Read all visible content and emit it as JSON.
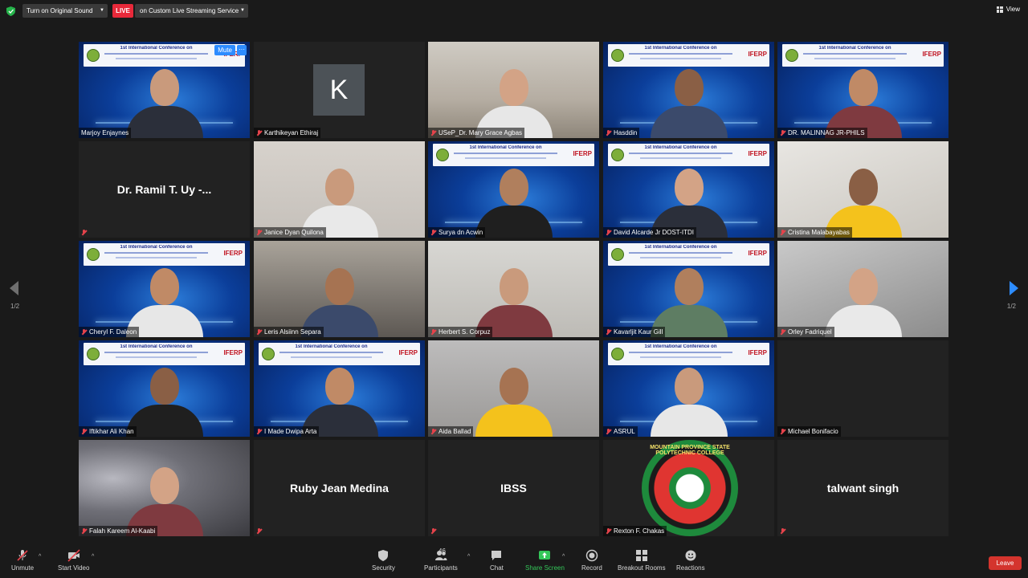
{
  "topbar": {
    "original_sound": "Turn on Original Sound",
    "live_badge": "LIVE",
    "streaming": "on Custom Live Streaming Service",
    "view": "View"
  },
  "participants": [
    {
      "name": "Marjoy Enjaynes",
      "kind": "banner"
    },
    {
      "name": "Karthikeyan Ethiraj",
      "kind": "avatar",
      "initial": "K"
    },
    {
      "name": "USeP_Dr. Mary Grace Agbas",
      "kind": "room"
    },
    {
      "name": "Hasddin",
      "kind": "banner"
    },
    {
      "name": "DR. MALINNAG JR-PHILS",
      "kind": "banner"
    },
    {
      "name": "Dr. Ramil T. Uy -...",
      "kind": "text"
    },
    {
      "name": "Janice Dyan Quilona",
      "kind": "room"
    },
    {
      "name": "Surya dn Acwin",
      "kind": "banner"
    },
    {
      "name": "David Alcarde Jr DOST-ITDI",
      "kind": "banner"
    },
    {
      "name": "Cristina Malabayabas",
      "kind": "room"
    },
    {
      "name": "Cheryl F. Daleon",
      "kind": "banner"
    },
    {
      "name": "Leris Alsiinn Separa",
      "kind": "room"
    },
    {
      "name": "Herbert S. Corpuz",
      "kind": "room"
    },
    {
      "name": "Kavarljit Kaur Gill",
      "kind": "banner"
    },
    {
      "name": "Orley Fadriquel",
      "kind": "room"
    },
    {
      "name": "Iftikhar Ali Khan",
      "kind": "banner"
    },
    {
      "name": "I Made Dwipa Arta",
      "kind": "banner"
    },
    {
      "name": "Aida Ballad",
      "kind": "room"
    },
    {
      "name": "ASRUL",
      "kind": "banner"
    },
    {
      "name": "Michael Bonifacio",
      "kind": "empty"
    },
    {
      "name": "Falah Kareem Al-Kaabi",
      "kind": "room"
    },
    {
      "name": "Ruby Jean Medina",
      "kind": "text"
    },
    {
      "name": "IBSS",
      "kind": "text"
    },
    {
      "name": "Rexton F. Chakas",
      "kind": "emblem"
    },
    {
      "name": "talwant singh",
      "kind": "text"
    }
  ],
  "banner": {
    "title": "1st International Conference on",
    "subtitle": "Engineering, Social - Sciences and Humanities",
    "brand": "IFERP"
  },
  "emblem_text": "MOUNTAIN PROVINCE STATE POLYTECHNIC COLLEGE",
  "active_tile": {
    "mute_label": "Mute",
    "more_label": "···"
  },
  "pagination": {
    "left": "1/2",
    "right": "1/2"
  },
  "toolbar": {
    "unmute": "Unmute",
    "start_video": "Start Video",
    "security": "Security",
    "participants": "Participants",
    "participants_count": "46",
    "chat": "Chat",
    "share_screen": "Share Screen",
    "record": "Record",
    "breakout_rooms": "Breakout Rooms",
    "reactions": "Reactions",
    "leave": "Leave"
  },
  "colors": {
    "accent_blue": "#2d8cff",
    "live_red": "#e8293a",
    "share_green": "#34c759",
    "leave_red": "#d4342d",
    "active_border": "#d7e56a"
  }
}
